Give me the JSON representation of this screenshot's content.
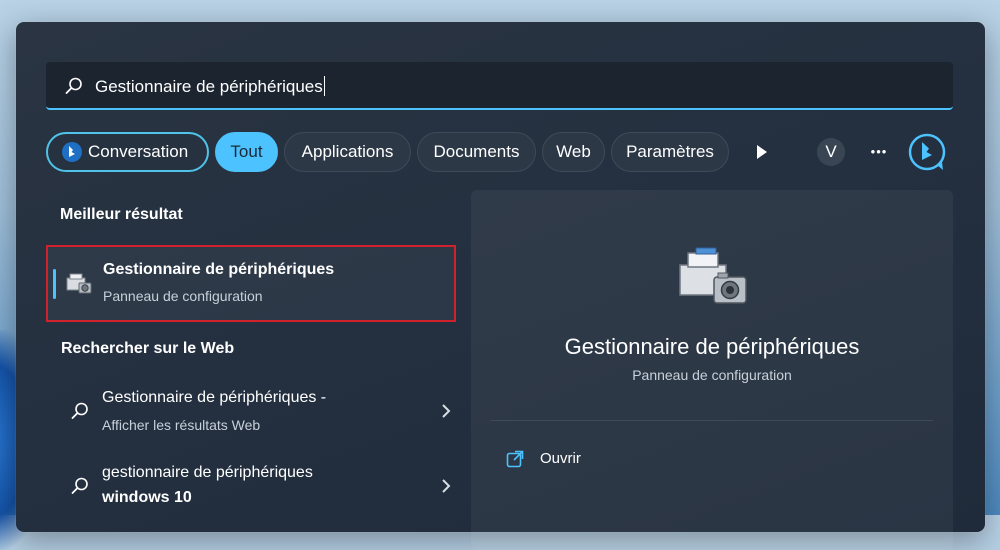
{
  "search": {
    "query": "Gestionnaire de périphériques",
    "icon": "search-icon"
  },
  "filters": {
    "conversation": "Conversation",
    "chips": [
      "Tout",
      "Applications",
      "Documents",
      "Web",
      "Paramètres"
    ],
    "active": "Tout",
    "avatar_letter": "V",
    "more": "•••"
  },
  "best_match": {
    "heading": "Meilleur résultat",
    "title": "Gestionnaire de périphériques",
    "subtitle": "Panneau de configuration"
  },
  "web": {
    "heading": "Rechercher sur le Web",
    "results": [
      {
        "line1": "Gestionnaire de périphériques -",
        "line2": "Afficher les résultats Web"
      },
      {
        "line1": "gestionnaire de périphériques",
        "line2": "windows 10"
      }
    ]
  },
  "preview": {
    "title": "Gestionnaire de périphériques",
    "subtitle": "Panneau de configuration",
    "actions": [
      "Ouvrir"
    ]
  },
  "colors": {
    "accent": "#4cc2ff",
    "highlight_border": "#d0212c",
    "panel_bg": "#243040"
  }
}
